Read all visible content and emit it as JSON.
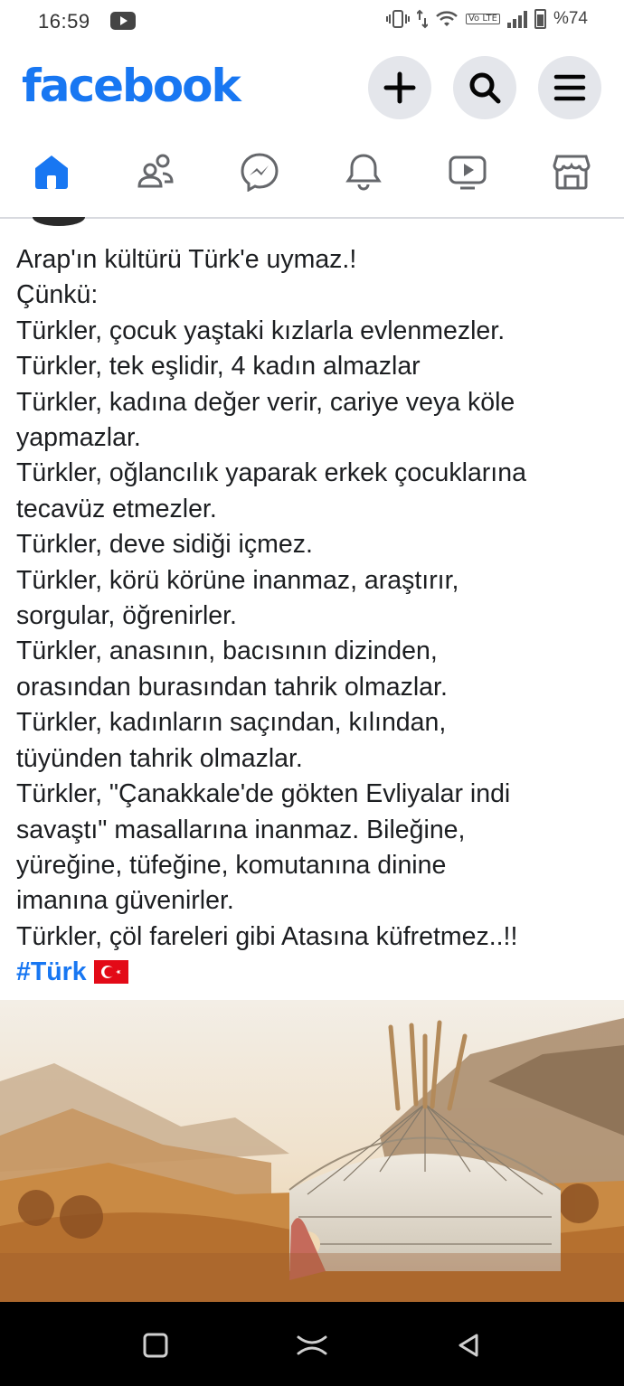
{
  "status_bar": {
    "time": "16:59",
    "battery": "%74",
    "volte": "Vo LTE"
  },
  "header": {
    "logo": "facebook",
    "brand_color": "#1877f2"
  },
  "tabs": [
    {
      "name": "home",
      "icon": "home-icon",
      "active": true
    },
    {
      "name": "friends",
      "icon": "friends-icon"
    },
    {
      "name": "messenger",
      "icon": "messenger-icon"
    },
    {
      "name": "notifications",
      "icon": "bell-icon"
    },
    {
      "name": "video",
      "icon": "video-icon"
    },
    {
      "name": "marketplace",
      "icon": "marketplace-icon"
    }
  ],
  "post": {
    "lines": [
      "Arap'ın kültürü Türk'e uymaz.!",
      "Çünkü:",
      "Türkler, çocuk yaştaki kızlarla evlenmezler.",
      "Türkler, tek eşlidir, 4 kadın almazlar",
      "Türkler, kadına değer verir, cariye veya köle",
      "yapmazlar.",
      "Türkler, oğlancılık yaparak erkek çocuklarına",
      "tecavüz etmezler.",
      "Türkler, deve sidiği içmez.",
      "Türkler, körü körüne inanmaz, araştırır,",
      "sorgular, öğrenirler.",
      "Türkler, anasının, bacısının dizinden,",
      "orasından burasından tahrik olmazlar.",
      "Türkler, kadınların saçından, kılından,",
      "tüyünden tahrik olmazlar.",
      "Türkler, \"Çanakkale'de gökten Evliyalar indi",
      "savaştı\" masallarına inanmaz. Bileğine,",
      "yüreğine, tüfeğine, komutanına dinine",
      "imanına güvenirler.",
      "Türkler, çöl fareleri gibi Atasına küfretmez..!!"
    ],
    "hashtag": "#Türk",
    "flag_icon": "turkish-flag-icon"
  }
}
